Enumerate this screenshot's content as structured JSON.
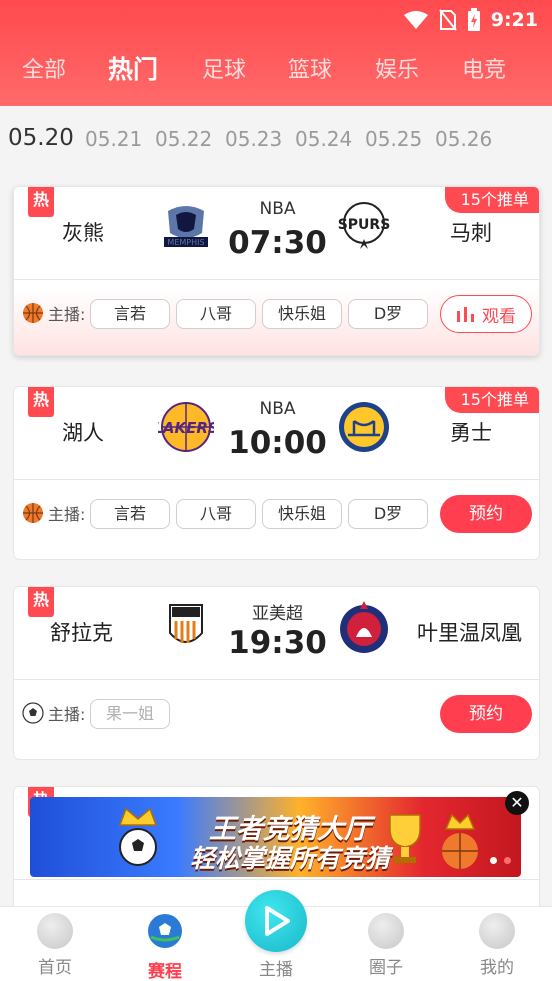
{
  "status": {
    "time": "9:21"
  },
  "categories": [
    "全部",
    "热门",
    "足球",
    "篮球",
    "娱乐",
    "电竞"
  ],
  "active_category": "热门",
  "dates": [
    "05.20",
    "05.21",
    "05.22",
    "05.23",
    "05.24",
    "05.25",
    "05.26"
  ],
  "matches": [
    {
      "hot": "热",
      "rec": "15个推单",
      "home": "灰熊",
      "away": "马刺",
      "league": "NBA",
      "time": "07:30",
      "anchor_label": "主播:",
      "anchors": [
        "言若",
        "八哥",
        "快乐姐",
        "D罗"
      ],
      "action": "观看"
    },
    {
      "hot": "热",
      "rec": "15个推单",
      "home": "湖人",
      "away": "勇士",
      "league": "NBA",
      "time": "10:00",
      "anchor_label": "主播:",
      "anchors": [
        "言若",
        "八哥",
        "快乐姐",
        "D罗"
      ],
      "action": "预约"
    },
    {
      "hot": "热",
      "home": "舒拉克",
      "away": "叶里温凤凰",
      "league": "亚美超",
      "time": "19:30",
      "anchor_label": "主播:",
      "anchors": [
        "果一姐"
      ],
      "action": "预约"
    },
    {
      "hot": "热"
    }
  ],
  "banner": {
    "line1": "王者竞猜大厅",
    "line2": "轻松掌握所有竞猜",
    "close": "✕"
  },
  "nav": [
    "首页",
    "赛程",
    "主播",
    "圈子",
    "我的"
  ],
  "colors": {
    "accent": "#ff4a52",
    "live": "#1ab7c7"
  }
}
